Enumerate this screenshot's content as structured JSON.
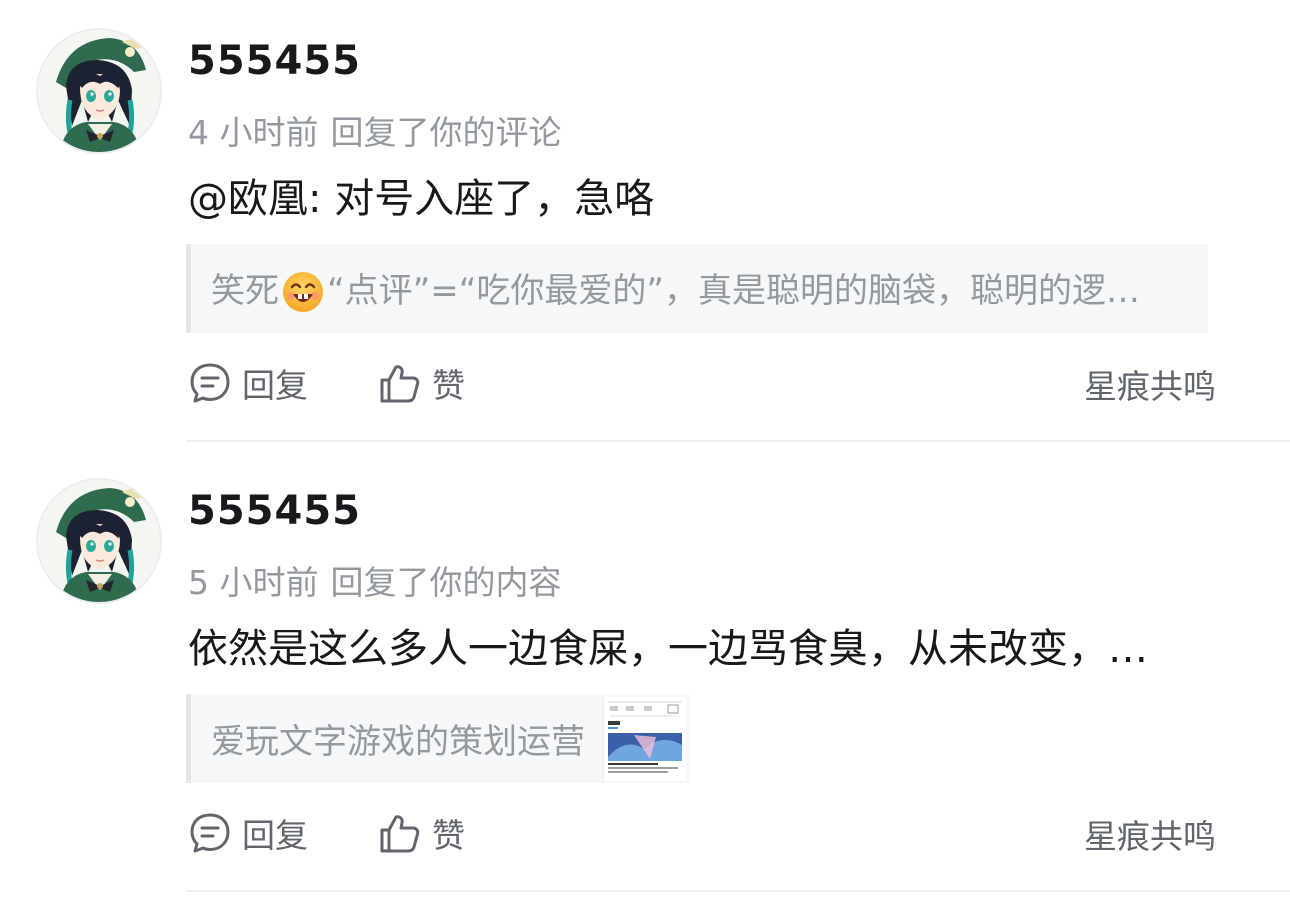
{
  "notifications": [
    {
      "username": "555455",
      "time": "4 小时前",
      "action": "回复了你的评论",
      "text": "@欧凰: 对号入座了，急咯",
      "quote": {
        "prefix": "笑死",
        "emoji_icon": "grinning-face-emoji-icon",
        "suffix": "“点评”=“吃你最爱的”，真是聪明的脑袋，聪明的逻…"
      },
      "reply_label": "回复",
      "like_label": "赞",
      "source_label": "星痕共鸣"
    },
    {
      "username": "555455",
      "time": "5 小时前",
      "action": "回复了你的内容",
      "text": "依然是这么多人一边食屎，一边骂食臭，从未改变，…",
      "quote": {
        "text": "爱玩文字游戏的策划运营",
        "thumbnail_icon": "content-thumbnail-image"
      },
      "reply_label": "回复",
      "like_label": "赞",
      "source_label": "星痕共鸣"
    }
  ],
  "colors": {
    "primary_text": "#18191c",
    "secondary_text": "#9499a0",
    "action_text": "#61666d",
    "quote_bg": "#f6f7f8",
    "divider": "#eceef0"
  }
}
